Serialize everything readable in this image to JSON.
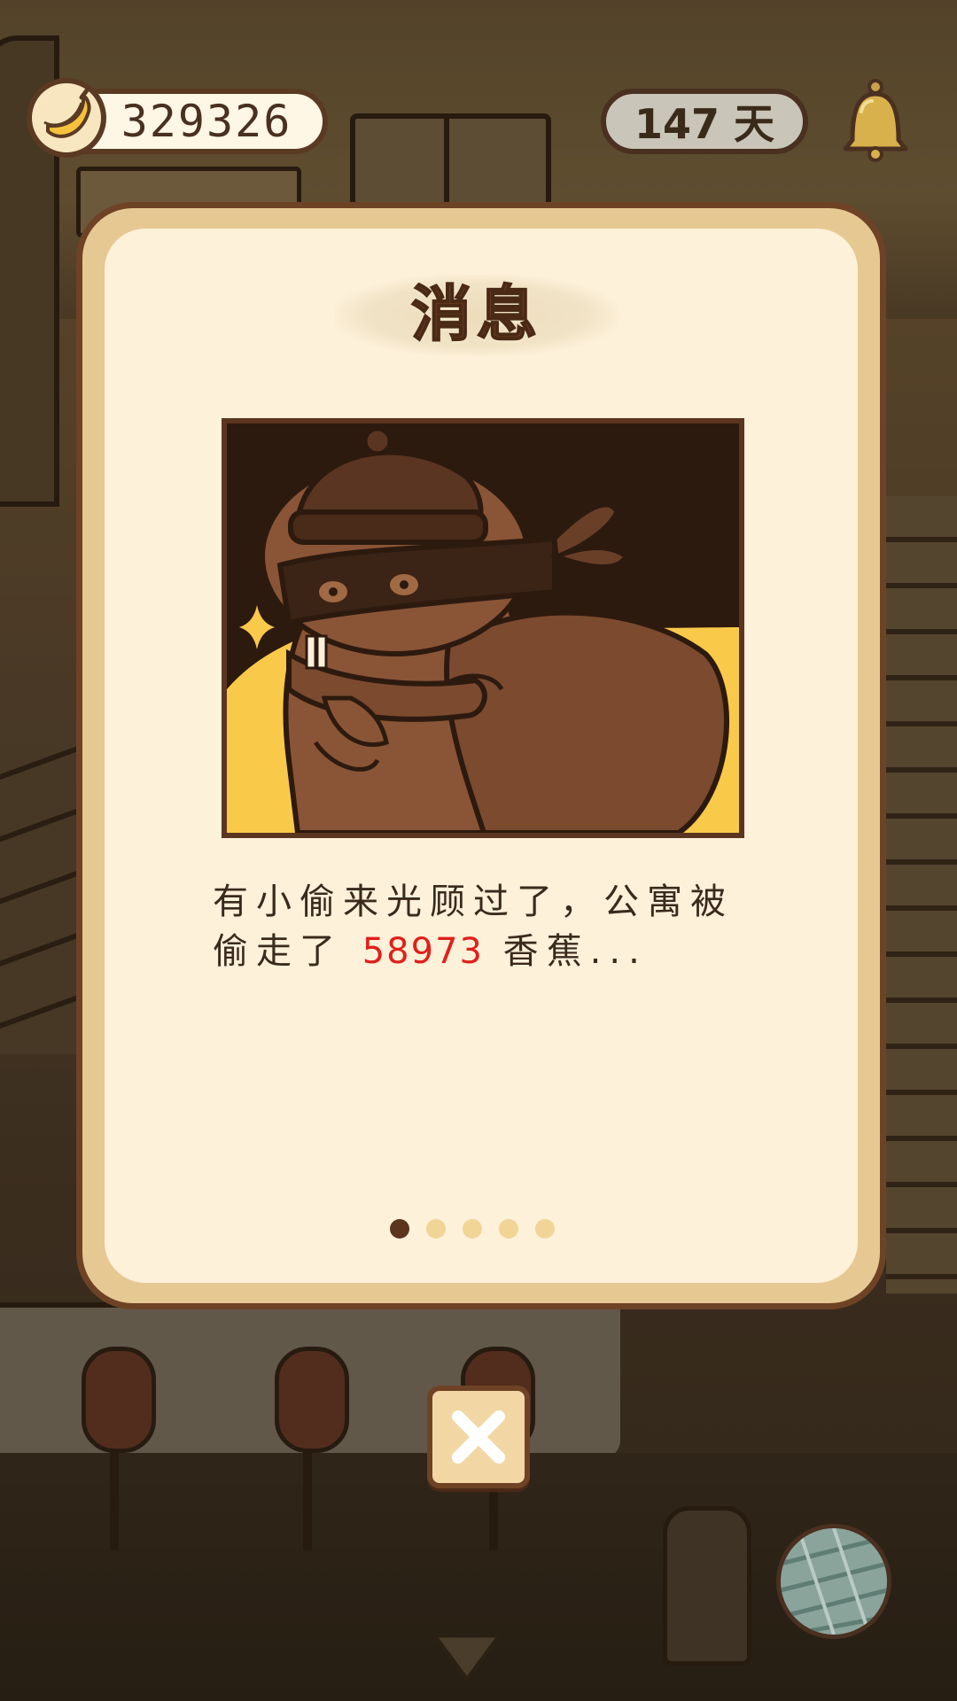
{
  "hud": {
    "banana_icon": "banana-icon",
    "banana_count": "329326",
    "days_label": "147 天",
    "bell_icon": "bell-icon"
  },
  "modal": {
    "title": "消息",
    "illustration": "thief-with-sack-illustration",
    "message_prefix": "有小偷来光顾过了，公寓被偷走了 ",
    "message_amount": "58973",
    "message_suffix": " 香蕉...",
    "pagination": {
      "total": 5,
      "current": 1
    },
    "close_icon": "close-icon"
  },
  "bottom": {
    "yarn_icon": "yarn-ball-icon",
    "down_arrow_icon": "down-arrow-icon"
  },
  "colors": {
    "modal_border": "#6e4325",
    "modal_frame": "#e6c893",
    "modal_background": "#fdf1da",
    "title": "#6a3f22",
    "amount_highlight": "#e0201a",
    "dot_active": "#5b3520",
    "dot_inactive": "#f1d596"
  }
}
